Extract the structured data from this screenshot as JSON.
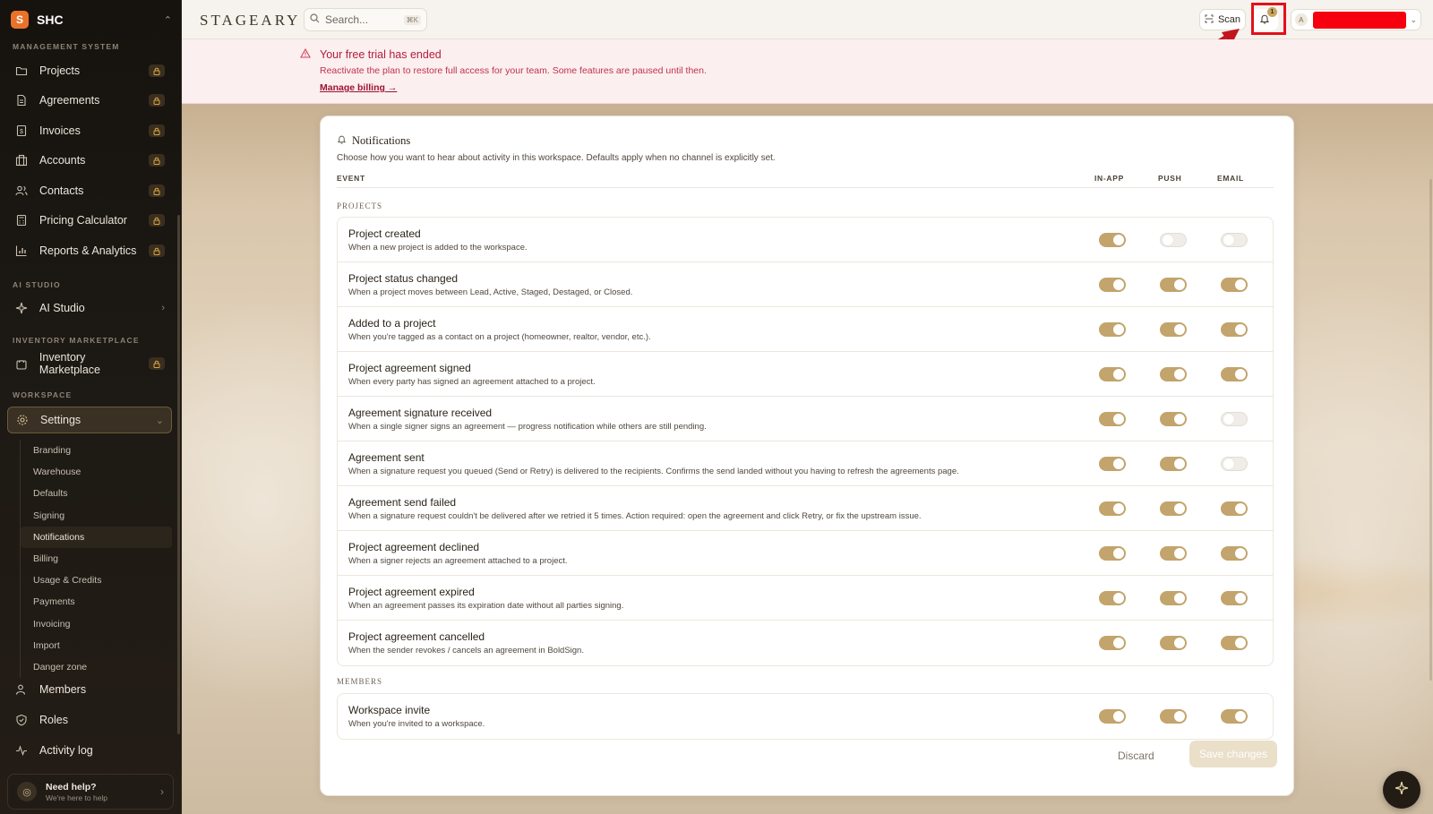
{
  "org": {
    "initial": "S",
    "name": "SHC"
  },
  "sidebar": {
    "sections": {
      "management": "MANAGEMENT SYSTEM",
      "ai": "AI STUDIO",
      "inventory": "INVENTORY MARKETPLACE",
      "workspace": "WORKSPACE"
    },
    "management_items": [
      {
        "label": "Projects",
        "icon": "folder-icon",
        "locked": true
      },
      {
        "label": "Agreements",
        "icon": "document-icon",
        "locked": true
      },
      {
        "label": "Invoices",
        "icon": "dollar-icon",
        "locked": true
      },
      {
        "label": "Accounts",
        "icon": "building-icon",
        "locked": true
      },
      {
        "label": "Contacts",
        "icon": "people-icon",
        "locked": true
      },
      {
        "label": "Pricing Calculator",
        "icon": "calculator-icon",
        "locked": true
      },
      {
        "label": "Reports & Analytics",
        "icon": "bar-chart-icon",
        "locked": true
      }
    ],
    "ai_studio": {
      "label": "AI Studio",
      "icon": "sparkle-icon"
    },
    "inventory_marketplace": {
      "label": "Inventory Marketplace",
      "icon": "bag-icon",
      "locked": true
    },
    "settings": {
      "label": "Settings",
      "icon": "gear-icon"
    },
    "settings_sub": [
      "Branding",
      "Warehouse",
      "Defaults",
      "Signing",
      "Notifications",
      "Billing",
      "Usage & Credits",
      "Payments",
      "Invoicing",
      "Import",
      "Danger zone"
    ],
    "active_sub": "Notifications",
    "bottom_items": [
      {
        "label": "Members",
        "icon": "member-icon"
      },
      {
        "label": "Roles",
        "icon": "shield-icon"
      },
      {
        "label": "Activity log",
        "icon": "activity-icon"
      }
    ],
    "help": {
      "title": "Need help?",
      "subtitle": "We're here to help"
    }
  },
  "topbar": {
    "brand": "STAGEARY",
    "search_placeholder": "Search...",
    "search_shortcut": "⌘K",
    "scan_label": "Scan",
    "notification_count": "1",
    "account_initial": "A"
  },
  "banner": {
    "title": "Your free trial has ended",
    "message": "Reactivate the plan to restore full access for your team. Some features are paused until then.",
    "link": "Manage billing →"
  },
  "notifications": {
    "title": "Notifications",
    "description": "Choose how you want to hear about activity in this workspace. Defaults apply when no channel is explicitly set.",
    "columns": {
      "event": "EVENT",
      "in_app": "IN-APP",
      "push": "PUSH",
      "email": "EMAIL"
    },
    "groups": [
      {
        "label": "PROJECTS",
        "rows": [
          {
            "title": "Project created",
            "desc": "When a new project is added to the workspace.",
            "in_app": true,
            "push": false,
            "email": false
          },
          {
            "title": "Project status changed",
            "desc": "When a project moves between Lead, Active, Staged, Destaged, or Closed.",
            "in_app": true,
            "push": true,
            "email": true
          },
          {
            "title": "Added to a project",
            "desc": "When you're tagged as a contact on a project (homeowner, realtor, vendor, etc.).",
            "in_app": true,
            "push": true,
            "email": true
          },
          {
            "title": "Project agreement signed",
            "desc": "When every party has signed an agreement attached to a project.",
            "in_app": true,
            "push": true,
            "email": true
          },
          {
            "title": "Agreement signature received",
            "desc": "When a single signer signs an agreement — progress notification while others are still pending.",
            "in_app": true,
            "push": true,
            "email": false
          },
          {
            "title": "Agreement sent",
            "desc": "When a signature request you queued (Send or Retry) is delivered to the recipients. Confirms the send landed without you having to refresh the agreements page.",
            "in_app": true,
            "push": true,
            "email": false
          },
          {
            "title": "Agreement send failed",
            "desc": "When a signature request couldn't be delivered after we retried it 5 times. Action required: open the agreement and click Retry, or fix the upstream issue.",
            "in_app": true,
            "push": true,
            "email": true
          },
          {
            "title": "Project agreement declined",
            "desc": "When a signer rejects an agreement attached to a project.",
            "in_app": true,
            "push": true,
            "email": true
          },
          {
            "title": "Project agreement expired",
            "desc": "When an agreement passes its expiration date without all parties signing.",
            "in_app": true,
            "push": true,
            "email": true
          },
          {
            "title": "Project agreement cancelled",
            "desc": "When the sender revokes / cancels an agreement in BoldSign.",
            "in_app": true,
            "push": true,
            "email": true
          }
        ]
      },
      {
        "label": "MEMBERS",
        "rows": [
          {
            "title": "Workspace invite",
            "desc": "When you're invited to a workspace.",
            "in_app": true,
            "push": true,
            "email": true
          }
        ]
      }
    ],
    "discard_label": "Discard",
    "save_label": "Save changes"
  },
  "colors": {
    "accent": "#c2a46c",
    "alert": "#b21e38",
    "highlight": "#e3101b"
  }
}
